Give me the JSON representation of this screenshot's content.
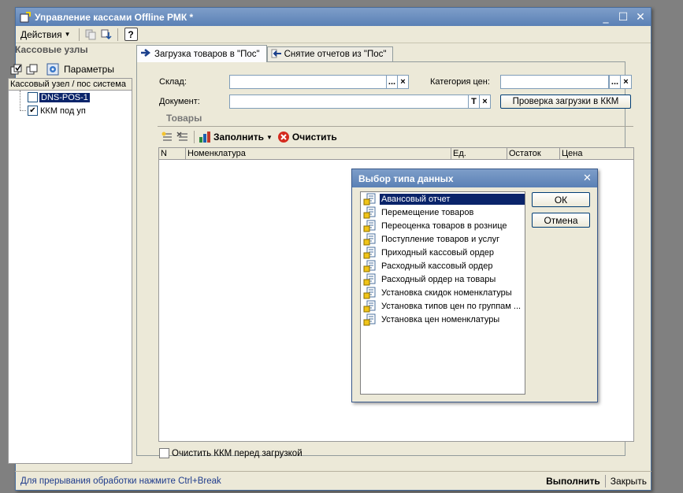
{
  "window": {
    "title": "Управление кассами Offline РМК *"
  },
  "menu": {
    "actions_label": "Действия",
    "help_label": "?"
  },
  "left_panel": {
    "title": "Кассовые узлы",
    "params_label": "Параметры",
    "tree_header": "Кассовый узел / пос система",
    "nodes": [
      {
        "label": "DNS-POS-1",
        "checked": false,
        "selected": true
      },
      {
        "label": "ККМ под уп",
        "checked": true,
        "selected": false
      }
    ]
  },
  "tabs": [
    {
      "label": "Загрузка товаров в \"Пос\"",
      "active": true
    },
    {
      "label": "Снятие отчетов из \"Пос\"",
      "active": false
    }
  ],
  "form": {
    "warehouse_label": "Склад:",
    "warehouse_value": "",
    "price_category_label": "Категория цен:",
    "price_category_value": "",
    "document_label": "Документ:",
    "document_value": "",
    "check_load_button": "Проверка загрузки в ККМ",
    "dots": "...",
    "clear_x": "×",
    "t_btn": "T"
  },
  "goods": {
    "section_title": "Товары",
    "fill_label": "Заполнить",
    "clear_label": "Очистить",
    "columns": [
      "N",
      "Номенклатура",
      "Ед.",
      "Остаток",
      "Цена"
    ],
    "rows": []
  },
  "bottom": {
    "clear_kkm_label": "Очистить ККМ перед загрузкой",
    "clear_kkm_checked": false
  },
  "status": {
    "hint": "Для прерывания обработки нажмите Ctrl+Break",
    "run_label": "Выполнить",
    "close_label": "Закрыть"
  },
  "dialog": {
    "title": "Выбор типа данных",
    "ok_label": "ОК",
    "cancel_label": "Отмена",
    "items": [
      "Авансовый отчет",
      "Перемещение товаров",
      "Переоценка товаров в рознице",
      "Поступление товаров и услуг",
      "Приходный кассовый ордер",
      "Расходный кассовый ордер",
      "Расходный ордер на товары",
      "Установка скидок номенклатуры",
      "Установка типов цен по группам ...",
      "Установка цен номенклатуры"
    ],
    "selected_index": 0
  },
  "colors": {
    "titlebar": "#5A80B5",
    "selection": "#0A246A",
    "window_bg": "#ECE9D8",
    "desktop": "#808080"
  }
}
